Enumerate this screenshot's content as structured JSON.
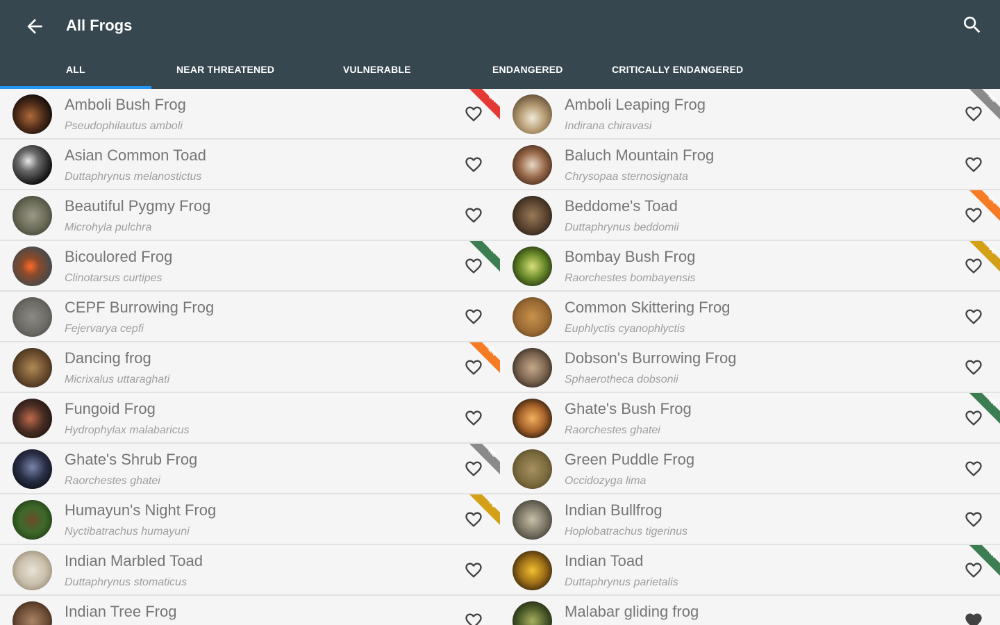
{
  "app_bar": {
    "title": "All Frogs",
    "back_icon": "arrow-left-icon",
    "search_icon": "search-icon"
  },
  "tabs": [
    {
      "label": "ALL",
      "selected": true
    },
    {
      "label": "NEAR THREATENED",
      "selected": false
    },
    {
      "label": "VULNERABLE",
      "selected": false
    },
    {
      "label": "ENDANGERED",
      "selected": false
    },
    {
      "label": "CRITICALLY ENDANGERED",
      "selected": false
    }
  ],
  "colors": {
    "app_bar": "#37474f",
    "tab_indicator": "#2196f3",
    "status_CR": "#e53935",
    "status_EN": "#f57c24",
    "status_VU": "#d4a017",
    "status_NT": "#3d7d52",
    "status_NE": "#8a8a8a"
  },
  "frogs_left": [
    {
      "name": "Amboli Bush Frog",
      "sci": "Pseudophilautus amboli",
      "status": "CR",
      "fav": false
    },
    {
      "name": "Asian Common Toad",
      "sci": "Duttaphrynus melanostictus",
      "status": "",
      "fav": false
    },
    {
      "name": "Beautiful Pygmy Frog",
      "sci": "Microhyla pulchra",
      "status": "",
      "fav": false
    },
    {
      "name": "Bicoulored Frog",
      "sci": "Clinotarsus curtipes",
      "status": "NT",
      "fav": false
    },
    {
      "name": "CEPF Burrowing Frog",
      "sci": "Fejervarya cepfi",
      "status": "",
      "fav": false
    },
    {
      "name": "Dancing frog",
      "sci": "Micrixalus uttaraghati",
      "status": "EN",
      "fav": false
    },
    {
      "name": "Fungoid Frog",
      "sci": "Hydrophylax malabaricus",
      "status": "",
      "fav": false
    },
    {
      "name": "Ghate's Shrub Frog",
      "sci": "Raorchestes ghatei",
      "status": "NE",
      "fav": false
    },
    {
      "name": "Humayun's Night Frog",
      "sci": "Nyctibatrachus humayuni",
      "status": "VU",
      "fav": false
    },
    {
      "name": "Indian Marbled Toad",
      "sci": "Duttaphrynus stomaticus",
      "status": "",
      "fav": false
    },
    {
      "name": "Indian Tree Frog",
      "sci": "",
      "status": "",
      "fav": false
    }
  ],
  "frogs_right": [
    {
      "name": "Amboli Leaping Frog",
      "sci": "Indirana chiravasi",
      "status": "NE",
      "fav": false
    },
    {
      "name": "Baluch Mountain Frog",
      "sci": "Chrysopaa sternosignata",
      "status": "",
      "fav": false
    },
    {
      "name": "Beddome's Toad",
      "sci": "Duttaphrynus beddomii",
      "status": "EN",
      "fav": false
    },
    {
      "name": "Bombay Bush Frog",
      "sci": "Raorchestes bombayensis",
      "status": "VU",
      "fav": false
    },
    {
      "name": "Common Skittering Frog",
      "sci": "Euphlyctis cyanophlyctis",
      "status": "",
      "fav": false
    },
    {
      "name": "Dobson's Burrowing Frog",
      "sci": "Sphaerotheca dobsonii",
      "status": "",
      "fav": false
    },
    {
      "name": "Ghate's Bush Frog",
      "sci": "Raorchestes ghatei",
      "status": "NT",
      "fav": false
    },
    {
      "name": "Green Puddle Frog",
      "sci": "Occidozyga lima",
      "status": "",
      "fav": false
    },
    {
      "name": "Indian Bullfrog",
      "sci": "Hoplobatrachus tigerinus",
      "status": "",
      "fav": false
    },
    {
      "name": "Indian Toad",
      "sci": "Duttaphrynus parietalis",
      "status": "NT",
      "fav": false
    },
    {
      "name": "Malabar gliding frog",
      "sci": "",
      "status": "",
      "fav": true
    }
  ]
}
